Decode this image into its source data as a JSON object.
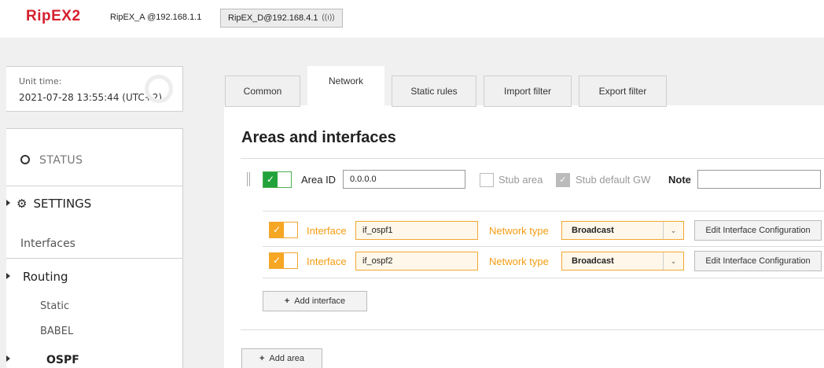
{
  "header": {
    "logo_text": "RipEX2",
    "unit_a": "RipEX_A @192.168.1.1",
    "unit_b": "RipEX_D@192.168.4.1"
  },
  "unit_time": {
    "label": "Unit time:",
    "value": "2021-07-28 13:55:44 (UTC+2)"
  },
  "menu": {
    "status": "STATUS",
    "settings": "SETTINGS",
    "interfaces": "Interfaces",
    "routing": "Routing",
    "static": "Static",
    "babel": "BABEL",
    "ospf": "OSPF"
  },
  "tabs": [
    {
      "label": "Common"
    },
    {
      "label": "Network"
    },
    {
      "label": "Static rules"
    },
    {
      "label": "Import filter"
    },
    {
      "label": "Export filter"
    }
  ],
  "section": {
    "title": "Areas and interfaces"
  },
  "area": {
    "area_id_label": "Area ID",
    "area_id_value": "0.0.0.0",
    "stub_area_label": "Stub area",
    "stub_area_checked": false,
    "stub_default_gw_label": "Stub default GW",
    "stub_default_gw_checked": true,
    "note_label": "Note",
    "note_value": "",
    "enabled": true
  },
  "interfaces": [
    {
      "label": "Interface",
      "value": "if_ospf1",
      "network_type_label": "Network type",
      "network_type": "Broadcast",
      "edit_label": "Edit Interface Configuration",
      "enabled": true
    },
    {
      "label": "Interface",
      "value": "if_ospf2",
      "network_type_label": "Network type",
      "network_type": "Broadcast",
      "edit_label": "Edit Interface Configuration",
      "enabled": true
    }
  ],
  "buttons": {
    "add_interface": "Add interface",
    "add_area": "Add area"
  },
  "colors": {
    "brand": "#d5202f",
    "toggle_green": "#22a33a",
    "toggle_orange": "#f5a623",
    "field_orange": "#f3a733"
  }
}
